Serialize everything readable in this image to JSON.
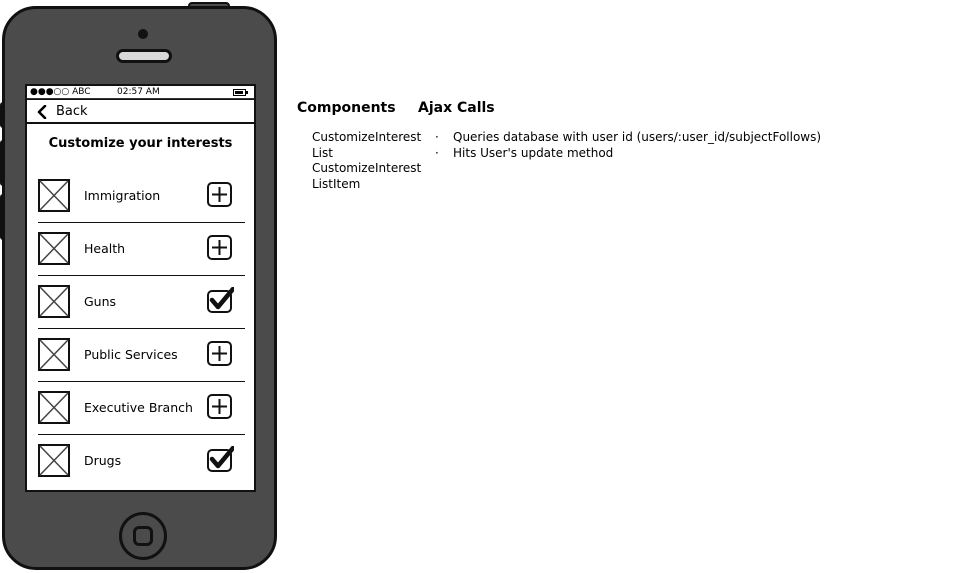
{
  "phone": {
    "status": {
      "carrier": "●●●○○ ABC",
      "time": "02:57 AM"
    },
    "nav": {
      "back_chevron": "chevron-left-icon",
      "back_label": "Back"
    },
    "title": "Customize your interests",
    "items": [
      {
        "label": "Immigration",
        "state": "add",
        "icon": "plus-square-icon"
      },
      {
        "label": "Health",
        "state": "add",
        "icon": "plus-square-icon"
      },
      {
        "label": "Guns",
        "state": "followed",
        "icon": "checkbox-checked-icon"
      },
      {
        "label": "Public Services",
        "state": "add",
        "icon": "plus-square-icon"
      },
      {
        "label": "Executive Branch",
        "state": "add",
        "icon": "plus-square-icon"
      },
      {
        "label": "Drugs",
        "state": "followed",
        "icon": "checkbox-checked-icon"
      }
    ]
  },
  "notes": {
    "components_heading": "Components",
    "ajax_heading": "Ajax Calls",
    "components": [
      "CustomizeInterest",
      "List",
      "CustomizeInterest",
      "ListItem"
    ],
    "bullet": "·",
    "ajax_calls": [
      "Queries database with user id (users/:user_id/subjectFollows)",
      "Hits User's update method"
    ]
  }
}
